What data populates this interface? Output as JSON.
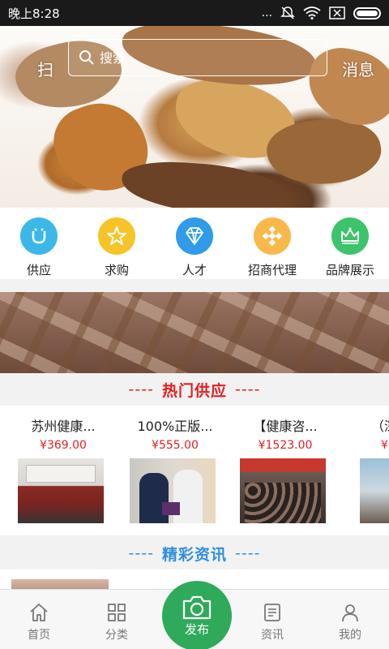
{
  "status_bar": {
    "time": "晚上8:28",
    "dots": "..."
  },
  "header": {
    "scan_label": "扫",
    "search_placeholder": "搜索",
    "message_label": "消息"
  },
  "banner": {
    "slide_count": 2,
    "active_slide": 2
  },
  "categories": [
    {
      "label": "供应",
      "icon": "u-icon",
      "color": "#3bb8e8"
    },
    {
      "label": "求购",
      "icon": "star-icon",
      "color": "#f6c427"
    },
    {
      "label": "人才",
      "icon": "diamond-icon",
      "color": "#2f9bea"
    },
    {
      "label": "招商代理",
      "icon": "grid-diamond-icon",
      "color": "#f8b84a"
    },
    {
      "label": "品牌展示",
      "icon": "crown-icon",
      "color": "#3cc46a"
    }
  ],
  "hot_supply": {
    "title": "热门供应",
    "dash": "----",
    "color": "#e02020"
  },
  "products": [
    {
      "name": "苏州健康...",
      "price": "¥369.00"
    },
    {
      "name": "100%正版...",
      "price": "¥555.00"
    },
    {
      "name": "【健康咨...",
      "price": "¥1523.00"
    },
    {
      "name": "（深",
      "price": "¥"
    }
  ],
  "news_section": {
    "title": "精彩资讯",
    "dash": "----",
    "color": "#2f8fe0"
  },
  "tabs": [
    {
      "label": "首页",
      "icon": "home-icon"
    },
    {
      "label": "分类",
      "icon": "category-grid-icon"
    },
    {
      "label": "资讯",
      "icon": "news-icon"
    },
    {
      "label": "我的",
      "icon": "user-icon"
    }
  ],
  "publish": {
    "label": "发布",
    "color": "#2faa5a"
  }
}
